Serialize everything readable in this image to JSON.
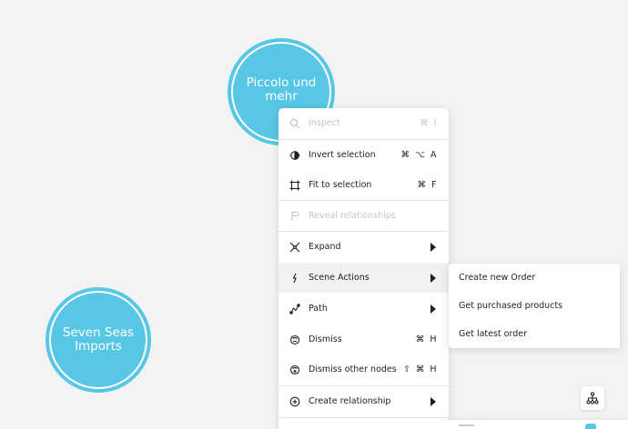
{
  "nodes": {
    "piccolo": {
      "label": "Piccolo und mehr"
    },
    "seven_seas": {
      "label": "Seven Seas Imports"
    }
  },
  "colors": {
    "node_fill": "#57c7e5",
    "node_ring": "#ffffff",
    "canvas": "#f3f3f3",
    "menu_bg": "#ffffff",
    "disabled_text": "#c4c4c4",
    "active_row": "#f1f1f1"
  },
  "context_menu": {
    "items": [
      {
        "label": "Inspect",
        "shortcut": "⌘ I",
        "icon": "search-icon",
        "disabled": true
      },
      {
        "label": "Invert selection",
        "shortcut": "⌘ ⌥ A",
        "icon": "invert-selection-icon"
      },
      {
        "label": "Fit to selection",
        "shortcut": "⌘ F",
        "icon": "fit-to-selection-icon"
      },
      {
        "label": "Reveal relationships",
        "shortcut": "",
        "icon": "reveal-relationships-icon",
        "disabled": true
      },
      {
        "label": "Expand",
        "icon": "expand-icon",
        "submenu": true
      },
      {
        "label": "Scene Actions",
        "icon": "scene-actions-icon",
        "submenu": true,
        "active": true
      },
      {
        "label": "Path",
        "icon": "path-icon",
        "submenu": true
      },
      {
        "label": "Dismiss",
        "shortcut": "⌘ H",
        "icon": "dismiss-icon"
      },
      {
        "label": "Dismiss other nodes",
        "shortcut": "⇧ ⌘ H",
        "icon": "dismiss-other-nodes-icon"
      },
      {
        "label": "Create relationship",
        "icon": "create-relationship-icon",
        "submenu": true
      }
    ]
  },
  "scene_actions_submenu": {
    "items": [
      {
        "label": "Create new Order"
      },
      {
        "label": "Get purchased products"
      },
      {
        "label": "Get latest order"
      }
    ]
  },
  "toolbar": {
    "layout_icon": "hierarchy-layout-icon"
  }
}
